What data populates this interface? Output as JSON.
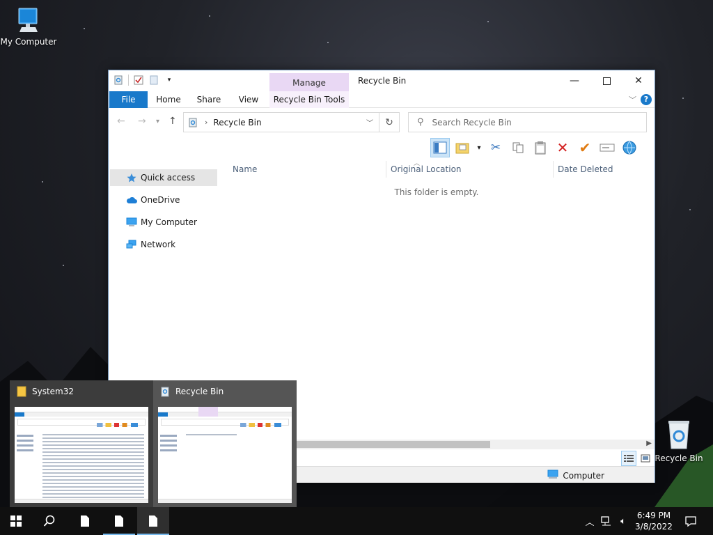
{
  "desktop": {
    "icons": [
      {
        "label": "My Computer"
      },
      {
        "label": "Recycle Bin"
      }
    ]
  },
  "window": {
    "title": "Recycle Bin",
    "contextual_tab_group": "Manage",
    "ribbon_tabs": [
      "File",
      "Home",
      "Share",
      "View",
      "Recycle Bin Tools"
    ],
    "address": {
      "crumb": "Recycle Bin"
    },
    "search": {
      "placeholder": "Search Recycle Bin"
    },
    "nav": [
      {
        "label": "Quick access"
      },
      {
        "label": "OneDrive"
      },
      {
        "label": "My Computer"
      },
      {
        "label": "Network"
      }
    ],
    "columns": [
      "Name",
      "Original Location",
      "Date Deleted"
    ],
    "empty_message": "This folder is empty.",
    "status_location": "Computer"
  },
  "thumbnails": [
    {
      "title": "System32"
    },
    {
      "title": "Recycle Bin"
    }
  ],
  "taskbar": {
    "time": "6:49 PM",
    "date": "3/8/2022"
  },
  "colors": {
    "accent": "#1979ca",
    "contextual": "#e9d8f4",
    "taskbar": "#101010"
  }
}
